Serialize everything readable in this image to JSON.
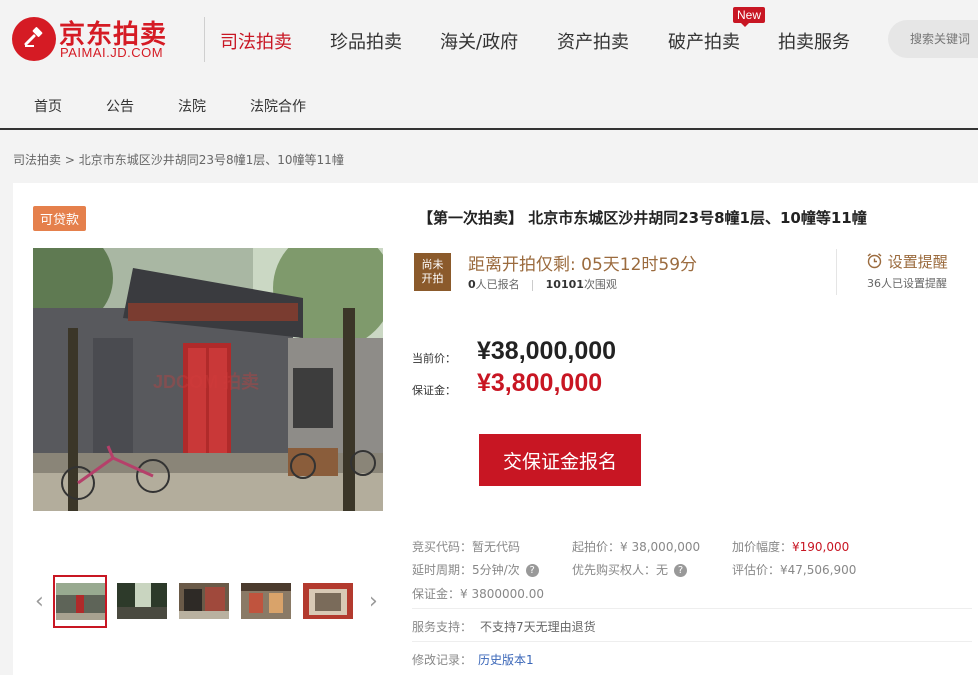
{
  "brand": {
    "name_cn": "京东拍卖",
    "name_en": "PAIMAI.JD.COM",
    "color": "#d51b24"
  },
  "main_nav": [
    {
      "label": "司法拍卖",
      "active": true
    },
    {
      "label": "珍品拍卖"
    },
    {
      "label": "海关/政府"
    },
    {
      "label": "资产拍卖"
    },
    {
      "label": "破产拍卖",
      "badge": "New"
    },
    {
      "label": "拍卖服务"
    }
  ],
  "search": {
    "placeholder": "搜索关键词"
  },
  "sub_nav": [
    "首页",
    "公告",
    "法院",
    "法院合作"
  ],
  "breadcrumb": {
    "root": "司法拍卖",
    "separator": ">",
    "current": "北京市东城区沙井胡同23号8幢1层、10幢等11幢"
  },
  "item": {
    "loan_tag": "可贷款",
    "title": "【第一次拍卖】 北京市东城区沙井胡同23号8幢1层、10幢等11幢",
    "photo_watermark": "JDCOM 拍卖",
    "status": {
      "line1": "尚未",
      "line2": "开拍"
    },
    "countdown": "距离开拍仅剩: 05天12时59分",
    "signup_count": "0",
    "signup_suffix": "人已报名",
    "watch_count": "10101",
    "watch_suffix": "次围观",
    "remind_label": "设置提醒",
    "remind_count": "36人已设置提醒",
    "current_price_label": "当前价：",
    "current_price": "¥38,000,000",
    "deposit_label": "保证金：",
    "deposit": "¥3,800,000",
    "signup_button": "交保证金报名",
    "details": {
      "bid_code": {
        "label": "竞买代码：",
        "value": "暂无代码"
      },
      "start_price": {
        "label": "起拍价：",
        "value": "¥ 38,000,000"
      },
      "increment": {
        "label": "加价幅度：",
        "value": "¥190,000"
      },
      "delay_cycle": {
        "label": "延时周期：",
        "value": "5分钟/次"
      },
      "priority_buyer": {
        "label": "优先购买权人：",
        "value": "无"
      },
      "assessed_price": {
        "label": "评估价：",
        "value": "¥47,506,900"
      },
      "deposit": {
        "label": "保证金：",
        "value": "¥ 3800000.00"
      },
      "service": {
        "label": "服务支持：",
        "value": "不支持7天无理由退货"
      },
      "history": {
        "label": "修改记录：",
        "value": "历史版本1"
      }
    }
  },
  "thumbnails": [
    "thumb-1",
    "thumb-2",
    "thumb-3",
    "thumb-4",
    "thumb-5"
  ],
  "colors": {
    "accent_red": "#c81623",
    "brown": "#9b6b3e",
    "status_brown": "#8b5a2b",
    "loan_orange": "#e5804c"
  }
}
